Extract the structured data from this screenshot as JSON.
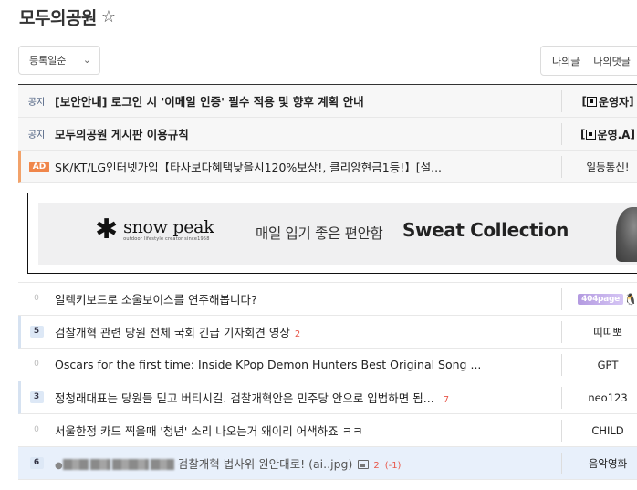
{
  "board": {
    "title": "모두의공원",
    "favorite_icon": "star-outline-icon"
  },
  "sort": {
    "selected": "등록일순"
  },
  "my_tabs": [
    "나의글",
    "나의댓글"
  ],
  "notices": [
    {
      "tag": "공지",
      "subject": "[보안안내] 로그인 시 '이메일 인증' 필수 적용 및 향후 계획 안내",
      "author": "운영자"
    },
    {
      "tag": "공지",
      "subject": "모두의공원 게시판 이용규칙",
      "author": "운영.A"
    }
  ],
  "ad": {
    "tag": "AD",
    "subject": "SK/KT/LG인터넷가입【타사보다혜택낮을시120%보상!, 클리앙현금1등!】[설...",
    "author": "일등통신!"
  },
  "banner": {
    "brand": "snow peak",
    "brand_sub": "outdoor lifestyle creator",
    "brand_since": "since1958",
    "copy": "매일 입기 좋은 편안함",
    "collection": "Sweat Collection"
  },
  "posts": [
    {
      "count": "0",
      "subject": "일렉키보드로 소울보이스를 연주해봅니다?",
      "comments": "",
      "author_badge": "404page",
      "author": ""
    },
    {
      "count": "5",
      "subject": "검찰개혁 관련 당원 전체 국회 긴급 기자회견 영상",
      "comments": "2",
      "author": "띠띠뽀"
    },
    {
      "count": "0",
      "subject": "Oscars for the first time: Inside KPop Demon Hunters Best Original Song ...",
      "comments": "",
      "author": "GPT"
    },
    {
      "count": "3",
      "subject": "정청래대표는 당원들 믿고 버티시길. 검찰개혁안은 민주당 안으로 입법하면 됩...",
      "comments": "7",
      "author": "neo123"
    },
    {
      "count": "0",
      "subject": "서울한정 카드 찍을때 '청년' 소리 나오는거 왜이리 어색하죠 ㅋㅋ",
      "comments": "",
      "author": "CHILD"
    },
    {
      "count": "6",
      "subject": "검찰개혁 법사위 원안대로! (ai..jpg)",
      "comments": "2",
      "comments_delta": "(-1)",
      "author": "음악영화"
    }
  ],
  "colors": {
    "ad_badge": "#f0864a",
    "comment": "#e8584b",
    "highlight_row": "#e8f0fb"
  }
}
